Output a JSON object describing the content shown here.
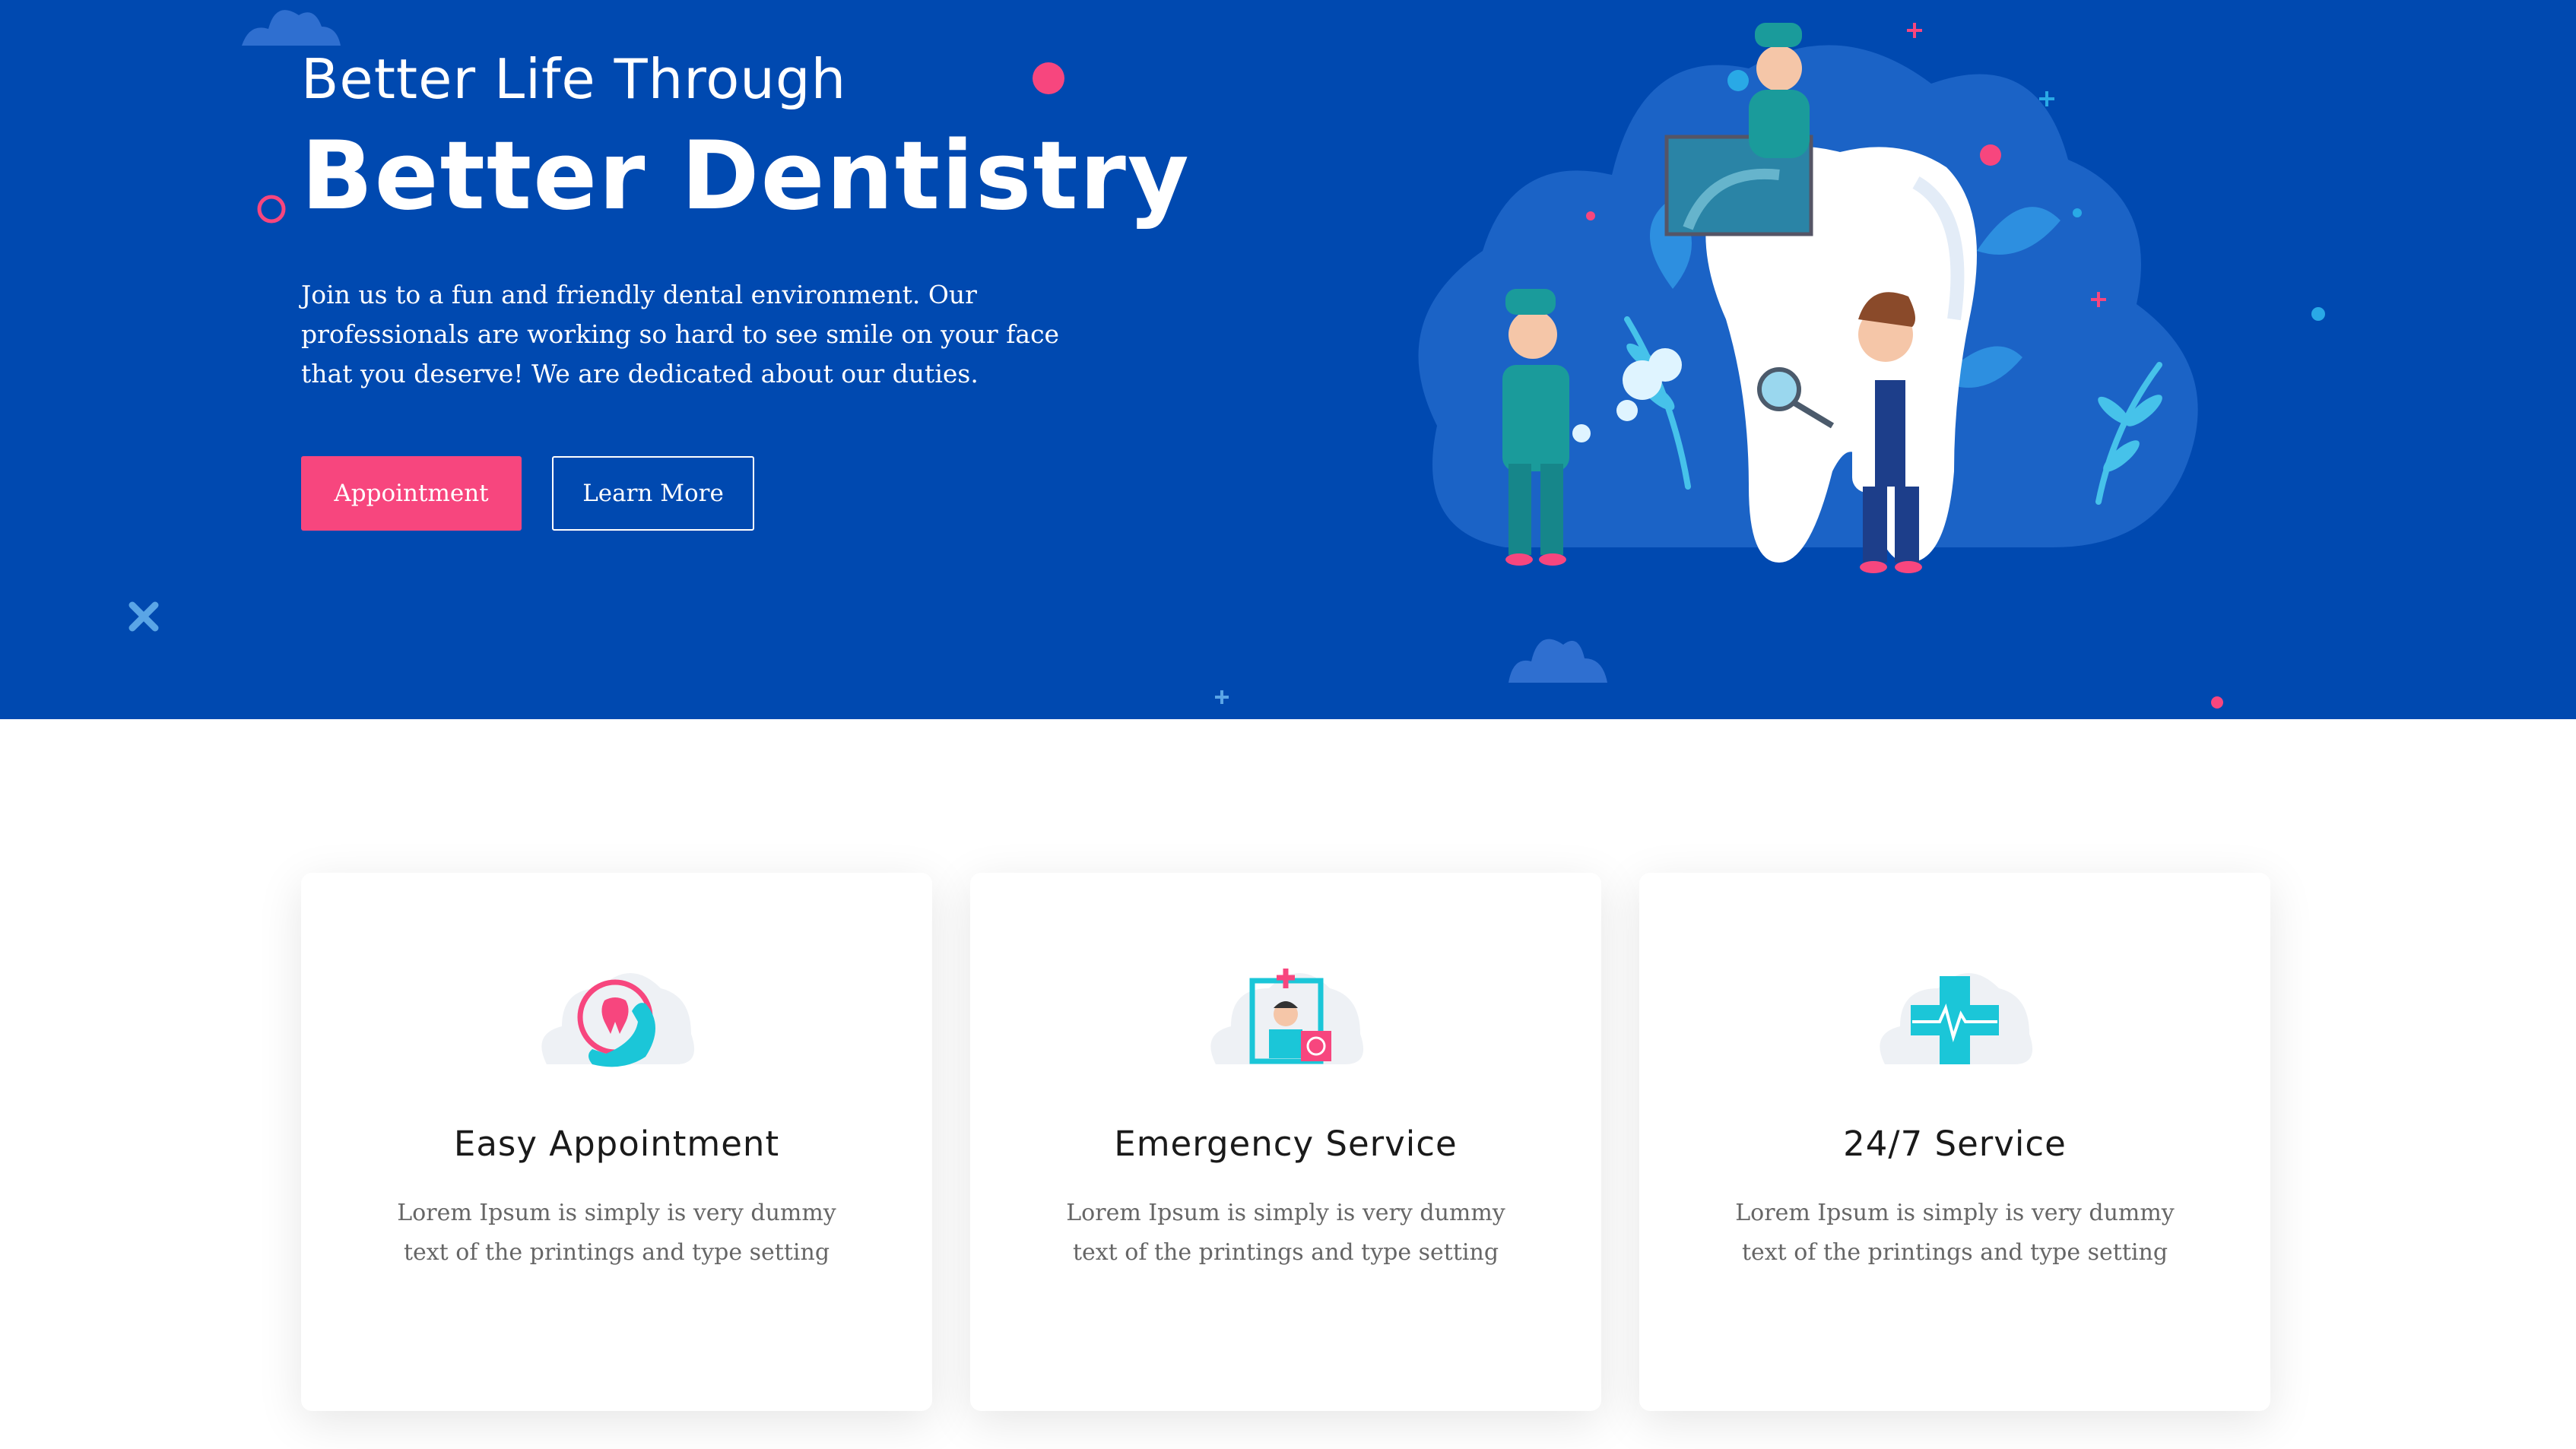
{
  "hero": {
    "subtitle": "Better Life Through",
    "title": "Better Dentistry",
    "description": "Join us to a fun and friendly dental environment. Our professionals are working so hard to see smile on your face that you deserve! We are dedicated about our duties.",
    "primary_button": "Appointment",
    "secondary_button": "Learn More",
    "illustration": "dentists-cleaning-tooth-illustration"
  },
  "features": [
    {
      "icon": "phone-tooth-icon",
      "title": "Easy Appointment",
      "text": "Lorem Ipsum is simply is very dummy text of the printings and type setting"
    },
    {
      "icon": "doctor-badge-icon",
      "title": "Emergency Service",
      "text": "Lorem Ipsum is simply is very dummy text of the printings and type setting"
    },
    {
      "icon": "medical-cross-icon",
      "title": "24/7 Service",
      "text": "Lorem Ipsum is simply is very dummy text of the printings and type setting"
    }
  ],
  "colors": {
    "hero_background": "#0049b0",
    "accent_pink": "#f7467e",
    "accent_cyan": "#1bc6d8",
    "card_title": "#1a1a1a",
    "card_text": "#666666"
  }
}
